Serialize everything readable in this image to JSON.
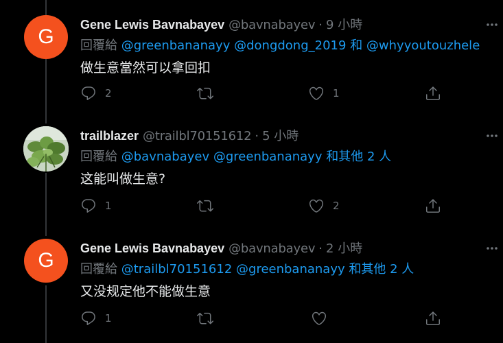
{
  "tweets": [
    {
      "avatar_letter": "G",
      "name": "Gene Lewis Bavnabayev",
      "handle": "@bavnabayev",
      "separator": "·",
      "time": "9 小時",
      "reply_prefix": "回覆給",
      "mentions": [
        "@greenbananayy",
        "@dongdong_2019"
      ],
      "reply_joiner": "和",
      "reply_last": "@whyyoutouzhele",
      "text": "做生意當然可以拿回扣",
      "reply_count": "2",
      "retweet_count": "",
      "like_count": "1"
    },
    {
      "avatar_letter": "",
      "name": "trailblazer",
      "handle": "@trailbl70151612",
      "separator": "·",
      "time": "5 小時",
      "reply_prefix": "回覆給",
      "mentions": [
        "@bavnabayev",
        "@greenbananayy"
      ],
      "reply_joiner": "和其他 2 人",
      "reply_last": "",
      "text": "这能叫做生意?",
      "reply_count": "1",
      "retweet_count": "",
      "like_count": "2"
    },
    {
      "avatar_letter": "G",
      "name": "Gene Lewis Bavnabayev",
      "handle": "@bavnabayev",
      "separator": "·",
      "time": "2 小時",
      "reply_prefix": "回覆給",
      "mentions": [
        "@trailbl70151612",
        "@greenbananayy"
      ],
      "reply_joiner": "和其他 2 人",
      "reply_last": "",
      "text": "又没规定他不能做生意",
      "reply_count": "1",
      "retweet_count": "",
      "like_count": ""
    }
  ],
  "colors": {
    "background": "#000000",
    "text": "#e7e9ea",
    "muted": "#71767b",
    "link": "#1d9bf0",
    "avatar_orange": "#f4511e"
  },
  "icons": [
    "reply-icon",
    "retweet-icon",
    "like-icon",
    "share-icon",
    "more-icon"
  ]
}
